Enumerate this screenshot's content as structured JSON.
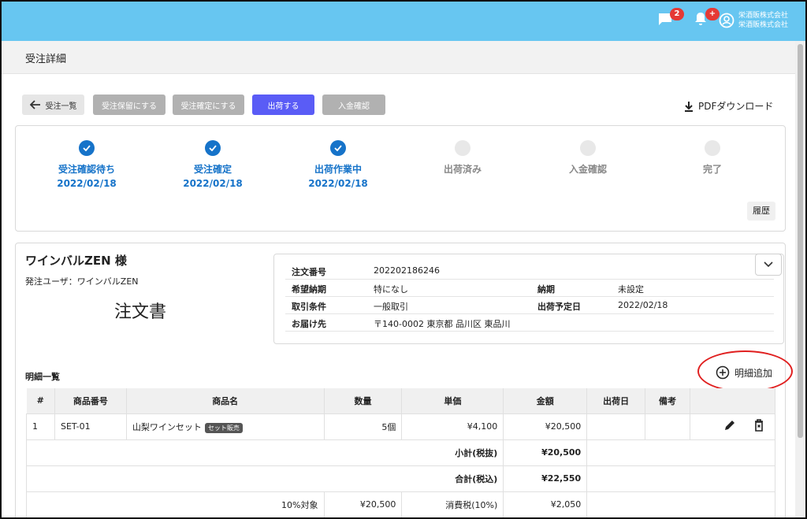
{
  "header": {
    "messages_badge": "2",
    "notifications_badge": "+",
    "account_line1": "栄酒販株式会社",
    "account_line2": "栄酒販株式会社"
  },
  "page": {
    "title": "受注詳細"
  },
  "toolbar": {
    "back_label": "受注一覧",
    "hold_label": "受注保留にする",
    "confirm_label": "受注確定にする",
    "ship_label": "出荷する",
    "payment_label": "入金確認",
    "pdf_label": "PDFダウンロード"
  },
  "steps": [
    {
      "label": "受注確認待ち",
      "date": "2022/02/18",
      "done": true
    },
    {
      "label": "受注確定",
      "date": "2022/02/18",
      "done": true
    },
    {
      "label": "出荷作業中",
      "date": "2022/02/18",
      "done": true
    },
    {
      "label": "出荷済み",
      "date": "",
      "done": false
    },
    {
      "label": "入金確認",
      "date": "",
      "done": false
    },
    {
      "label": "完了",
      "date": "",
      "done": false
    }
  ],
  "history_label": "履歴",
  "customer": {
    "name": "ワインバルZEN 様",
    "user": "発注ユーザ：ワインバルZEN",
    "doc_title": "注文書"
  },
  "order_info": {
    "order_no_label": "注文番号",
    "order_no": "202202186246",
    "desired_label": "希望納期",
    "desired": "特になし",
    "deadline_label": "納期",
    "deadline": "未設定",
    "terms_label": "取引条件",
    "terms": "一般取引",
    "ship_date_label": "出荷予定日",
    "ship_date": "2022/02/18",
    "address_label": "お届け先",
    "address": "〒140-0002 東京都 品川区 東品川"
  },
  "items": {
    "title": "明細一覧",
    "add_label": "明細追加",
    "columns": [
      "#",
      "商品番号",
      "商品名",
      "数量",
      "単価",
      "金額",
      "出荷日",
      "備考"
    ],
    "rows": [
      {
        "no": "1",
        "code": "SET-01",
        "name": "山梨ワインセット",
        "tag": "セット販売",
        "qty": "5個",
        "price": "¥4,100",
        "amount": "¥20,500",
        "ship_date": "",
        "note": ""
      }
    ],
    "subtotal_label": "小計(税抜)",
    "subtotal": "¥20,500",
    "total_label": "合計(税込)",
    "total": "¥22,550",
    "tax_target_label": "10%対象",
    "tax_target": "¥20,500",
    "tax_label": "消費税(10%)",
    "tax": "¥2,050"
  },
  "colors": {
    "header": "#67c6f1",
    "primary": "#5a5cf6",
    "step": "#1673c9",
    "annotation": "#e02020"
  }
}
